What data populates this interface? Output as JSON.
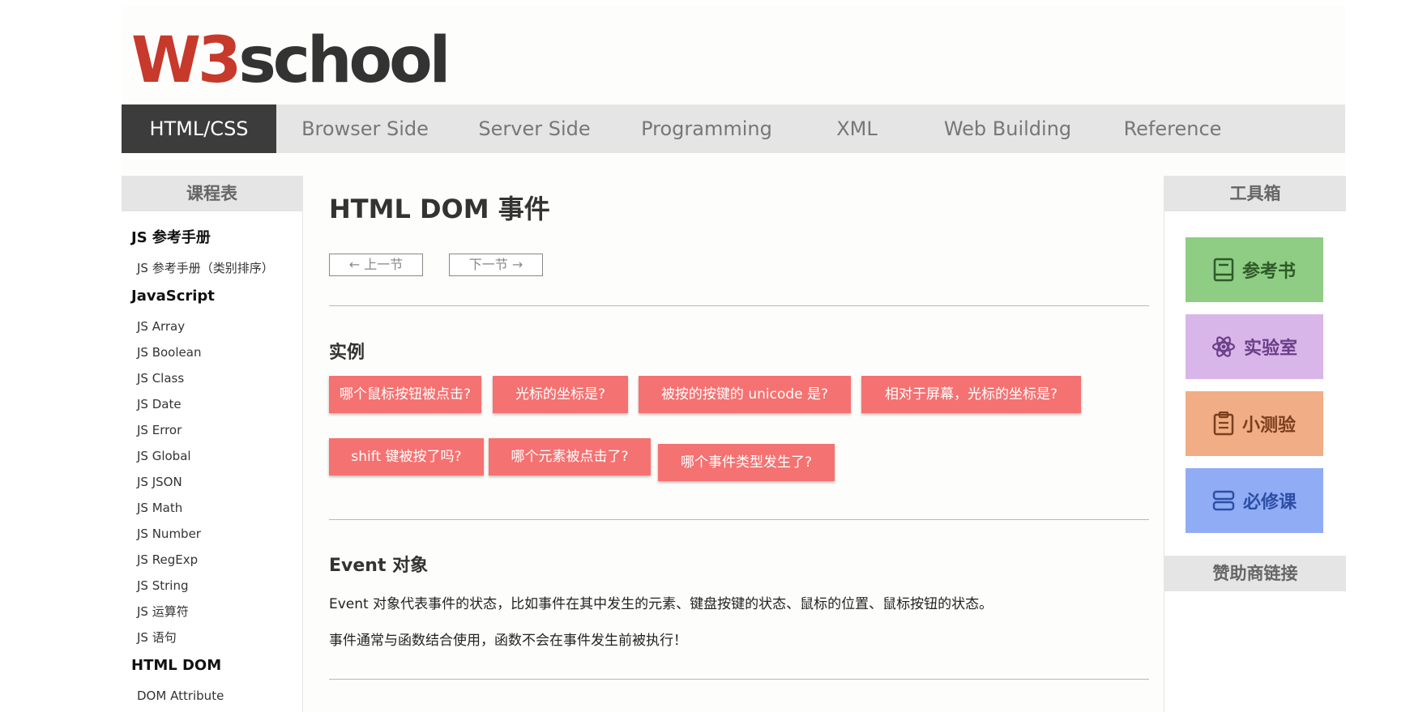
{
  "logo": {
    "part1": "W3",
    "part2": "school"
  },
  "nav": [
    {
      "label": "HTML/CSS"
    },
    {
      "label": "Browser Side"
    },
    {
      "label": "Server Side"
    },
    {
      "label": "Programming"
    },
    {
      "label": "XML"
    },
    {
      "label": "Web Building"
    },
    {
      "label": "Reference"
    }
  ],
  "left_sidebar": {
    "heading": "课程表",
    "group1": "JS 参考手册",
    "group1_link": "JS 参考手册（类别排序）",
    "group2": "JavaScript",
    "links": [
      "JS Array",
      "JS Boolean",
      "JS Class",
      "JS Date",
      "JS Error",
      "JS Global",
      "JS JSON",
      "JS Math",
      "JS Number",
      "JS RegExp",
      "JS String",
      "JS 运算符",
      "JS 语句"
    ],
    "group3": "HTML DOM",
    "group3_link": "DOM Attribute"
  },
  "main": {
    "title": "HTML DOM 事件",
    "prev": "← 上一节",
    "next": "下一节 →",
    "examples_heading": "实例",
    "examples": [
      "哪个鼠标按钮被点击?",
      "光标的坐标是?",
      "被按的按键的 unicode 是?",
      "相对于屏幕，光标的坐标是?",
      "shift 键被按了吗?",
      "哪个元素被点击了?",
      "哪个事件类型发生了?"
    ],
    "event_heading": "Event 对象",
    "event_p1": "Event 对象代表事件的状态，比如事件在其中发生的元素、键盘按键的状态、鼠标的位置、鼠标按钮的状态。",
    "event_p2": "事件通常与函数结合使用，函数不会在事件发生前被执行！"
  },
  "right_sidebar": {
    "heading": "工具箱",
    "tools": [
      {
        "label": "参考书",
        "icon": "book-icon"
      },
      {
        "label": "实验室",
        "icon": "atom-icon"
      },
      {
        "label": "小测验",
        "icon": "clipboard-icon"
      },
      {
        "label": "必修课",
        "icon": "course-icon"
      }
    ],
    "sponsor_heading": "赞助商链接"
  },
  "colors": {
    "accent_red": "#c7392b",
    "example_button": "#f47271",
    "nav_active": "#3c3c3c"
  }
}
